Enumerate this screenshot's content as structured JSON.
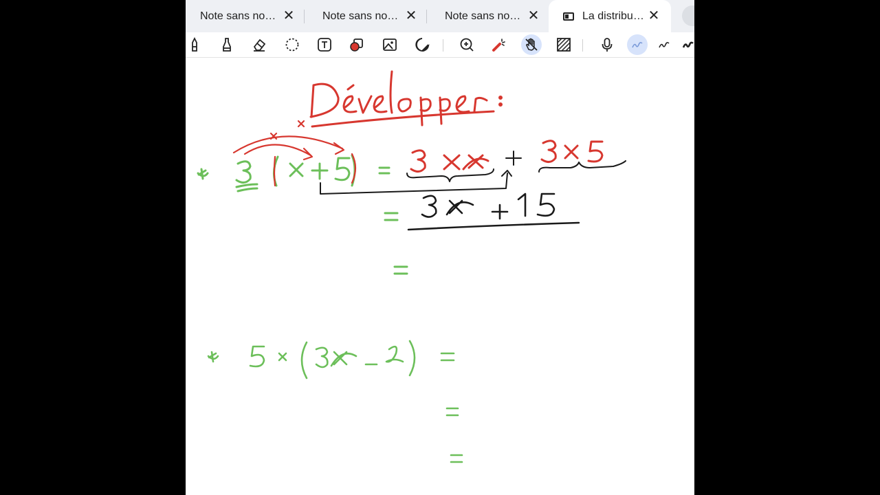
{
  "tabs": [
    {
      "label": "Note sans no…",
      "active": false
    },
    {
      "label": "Note sans no…",
      "active": false
    },
    {
      "label": "Note sans no…",
      "active": false
    },
    {
      "label": "La distribu…",
      "active": true
    }
  ],
  "toolbar": {
    "tools": [
      "pen-icon",
      "highlighter-icon",
      "eraser-icon",
      "lasso-icon",
      "text-icon",
      "shape-icon",
      "image-icon",
      "sticker-icon",
      "zoom-icon",
      "laser-icon",
      "hand-icon",
      "pattern-icon",
      "microphone-icon",
      "stroke-style-icon",
      "stroke-style-icon",
      "stroke-style-icon"
    ],
    "selected_tool": "hand-icon"
  },
  "colors": {
    "ink_red": "#d7372f",
    "ink_green": "#6cbf5a",
    "ink_black": "#1a1a1a",
    "accent": "#d7e3fb"
  }
}
